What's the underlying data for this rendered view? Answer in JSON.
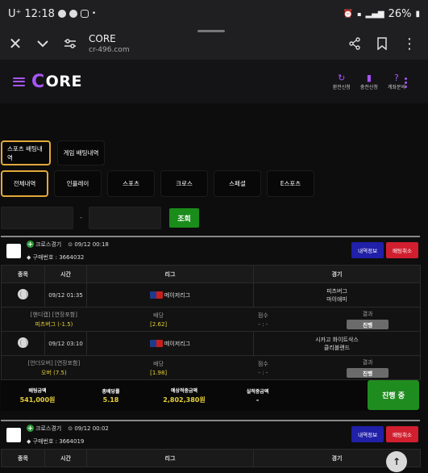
{
  "status": {
    "carrier": "U⁺",
    "time": "12:18",
    "battery": "26%"
  },
  "browser": {
    "title": "CORE",
    "url": "cr-496.com"
  },
  "header": {
    "brand": "ORE",
    "actions": [
      {
        "icon": "refund-icon",
        "label": "환전신청"
      },
      {
        "icon": "charge-icon",
        "label": "충전신청"
      },
      {
        "icon": "question-icon",
        "label": "계좌문의"
      }
    ]
  },
  "tabs_top": [
    "스포츠 배팅내역",
    "게임 배팅내역"
  ],
  "tabs_filter": [
    "전체내역",
    "인플레이",
    "스포츠",
    "크로스",
    "스페셜",
    "E스포츠"
  ],
  "search": {
    "separator": "-",
    "button": "조회"
  },
  "table_headers": [
    "종목",
    "시간",
    "리그",
    "경기"
  ],
  "cards": [
    {
      "type_label": "크로스경기",
      "datetime": "09/12 00:18",
      "purchase": "구매번호 : 3664032",
      "btn_info": "내역정보",
      "btn_cancel": "배팅취소",
      "games": [
        {
          "time": "09/12 01:35",
          "league": "메이저리그",
          "match_home": "피츠버그",
          "match_away": "마이애미",
          "bet_type": "[핸디캡] [연장포함]",
          "bet_pick": "피츠버그 (-1.5)",
          "odds_label": "배당",
          "odds": "[2.62]",
          "score_label": "점수",
          "score": "- : -",
          "result_label": "결과",
          "result": "진행"
        },
        {
          "time": "09/12 03:10",
          "league": "메이저리그",
          "match_home": "시카고 화이트삭스",
          "match_away": "클리블랜드",
          "bet_type": "[언더오버] [연장포함]",
          "bet_pick": "오버 (7.5)",
          "odds_label": "배당",
          "odds": "[1.98]",
          "score_label": "점수",
          "score": "- : -",
          "result_label": "결과",
          "result": "진행"
        }
      ],
      "summary": {
        "bet_amount_label": "배팅금액",
        "bet_amount": "541,000원",
        "total_odds_label": "총배당률",
        "total_odds": "5.18",
        "expected_label": "예상적중금액",
        "expected": "2,802,380원",
        "actual_label": "실적중금액",
        "actual": "-",
        "state": "진행 중"
      }
    },
    {
      "type_label": "크로스경기",
      "datetime": "09/12 00:02",
      "purchase": "구매번호 : 3664019",
      "btn_info": "내역정보",
      "btn_cancel": "배팅취소"
    }
  ],
  "colors": {
    "accent_purple": "#a855f7",
    "active_tab_border": "#e2a93b",
    "green": "#1f8c1f",
    "yellow_value": "#e7d037",
    "info_blue": "#2020a8",
    "cancel_red": "#d11f2f"
  }
}
